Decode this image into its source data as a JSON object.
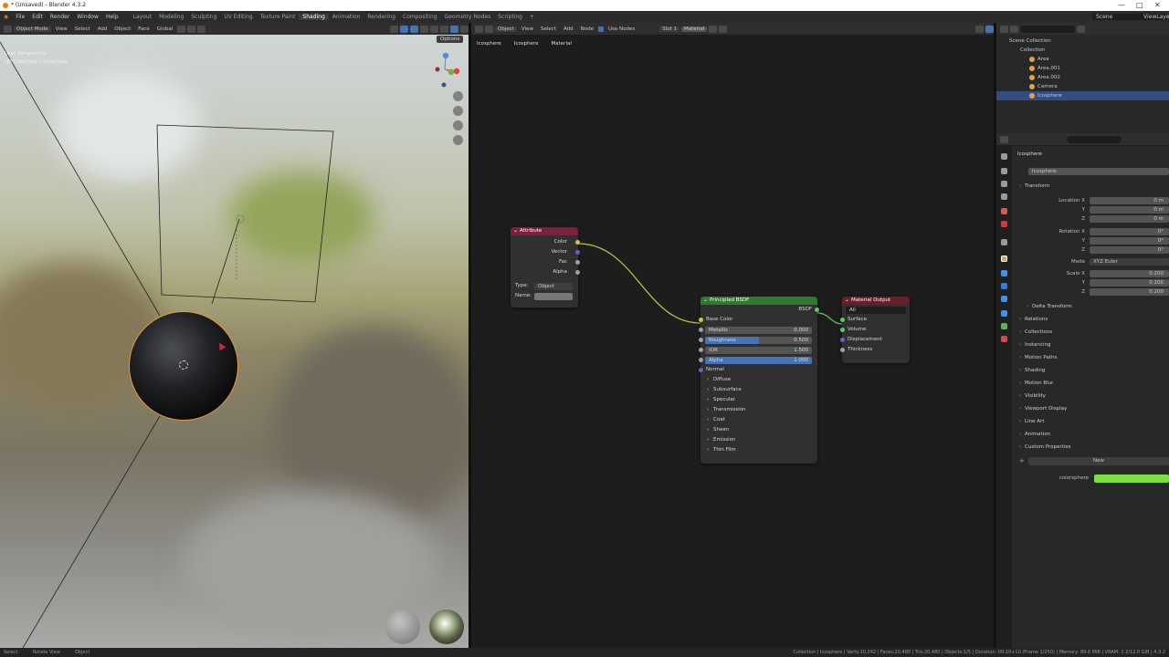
{
  "window": {
    "title": "* (Unsaved) - Blender 4.3.2",
    "controls": [
      "—",
      "□",
      "✕"
    ]
  },
  "menu": {
    "items": [
      "File",
      "Edit",
      "Render",
      "Window",
      "Help"
    ]
  },
  "workspaces": {
    "tabs": [
      "Layout",
      "Modeling",
      "Sculpting",
      "UV Editing",
      "Texture Paint",
      "Shading",
      "Animation",
      "Rendering",
      "Compositing",
      "Geometry Nodes",
      "Scripting",
      "+"
    ],
    "active": "Shading"
  },
  "scene": {
    "name": "Scene",
    "viewlayer": "ViewLayer"
  },
  "viewport": {
    "mode": "Object Mode",
    "menus": [
      "View",
      "Select",
      "Add",
      "Object",
      "Face"
    ],
    "transform": "Global",
    "options": "Options",
    "overlay_line1": "User Perspective",
    "overlay_line2": "(1) Collection | Icosphere",
    "gizmo": {
      "x": "X",
      "y": "Y",
      "z": "Z"
    }
  },
  "node_editor": {
    "object_label": "Object",
    "menus": [
      "View",
      "Select",
      "Add",
      "Node"
    ],
    "use_nodes": "Use Nodes",
    "slot": "Slot 1",
    "material": "Material",
    "breadcrumb": [
      "Icosphere",
      "Icosphere",
      "Material"
    ],
    "attribute_node": {
      "title": "Attribute",
      "outputs": [
        "Color",
        "Vector",
        "Fac",
        "Alpha"
      ],
      "type_label": "Type:",
      "type_value": "Object",
      "name_label": "Name:",
      "name_value": ""
    },
    "bsdf_node": {
      "title": "Principled BSDF",
      "output": "BSDF",
      "base_color": "Base Color",
      "fields": [
        {
          "label": "Metallic",
          "value": "0.000",
          "fill": 0
        },
        {
          "label": "Roughness",
          "value": "0.500",
          "fill": 0.5
        },
        {
          "label": "IOR",
          "value": "1.500",
          "fill": 0
        },
        {
          "label": "Alpha",
          "value": "1.000",
          "fill": 1
        }
      ],
      "normal": "Normal",
      "panels": [
        "Diffuse",
        "Subsurface",
        "Specular",
        "Transmission",
        "Coat",
        "Sheen",
        "Emission",
        "Thin Film"
      ]
    },
    "output_node": {
      "title": "Material Output",
      "target": "All",
      "inputs": [
        "Surface",
        "Volume",
        "Displacement",
        "Thickness"
      ]
    }
  },
  "outliner": {
    "root": "Scene Collection",
    "collection": "Collection",
    "items": [
      "Area",
      "Area.001",
      "Area.002",
      "Camera",
      "Icosphere"
    ],
    "selected": "Icosphere"
  },
  "properties": {
    "object_name": "Icosphere",
    "name_field": "Icosphere",
    "transform_header": "Transform",
    "location": {
      "label": "Location X",
      "x": "0 m",
      "y": "0 m",
      "z": "0 m"
    },
    "rotation": {
      "label": "Rotation X",
      "x": "0°",
      "y": "0°",
      "z": "0°"
    },
    "mode": {
      "label": "Mode",
      "value": "XYZ Euler"
    },
    "scale": {
      "label": "Scale X",
      "x": "0.200",
      "y": "0.200",
      "z": "0.200"
    },
    "axis_labels": [
      "Y",
      "Z"
    ],
    "delta": "Delta Transform",
    "panels": [
      "Relations",
      "Collections",
      "Instancing",
      "Motion Paths",
      "Shading",
      "Motion Blur",
      "Visibility",
      "Viewport Display",
      "Line Art",
      "Animation"
    ],
    "custom_header": "Custom Properties",
    "new_button": "New",
    "custom_prop_name": "colorsphere",
    "custom_prop_color": "#7ee040"
  },
  "status_bar": {
    "left": [
      "Select",
      "Rotate View",
      "Object"
    ],
    "right": "Collection | Icosphere | Verts:10,242 | Faces:20,480 | Tris:20,480 | Objects:1/5 | Duration: 00:10+10 (Frame 1/250) | Memory: 89.6 MiB | VRAM: 2.2/12.0 GiB | 4.3.2"
  },
  "colors": {
    "header": "#2e2e2e",
    "accent_blue": "#4772b3",
    "attribute_header": "#7d1f3e",
    "bsdf_header": "#2f7a2f",
    "output_header": "#6b1d2a",
    "selection_outline": "#e89a3c"
  }
}
